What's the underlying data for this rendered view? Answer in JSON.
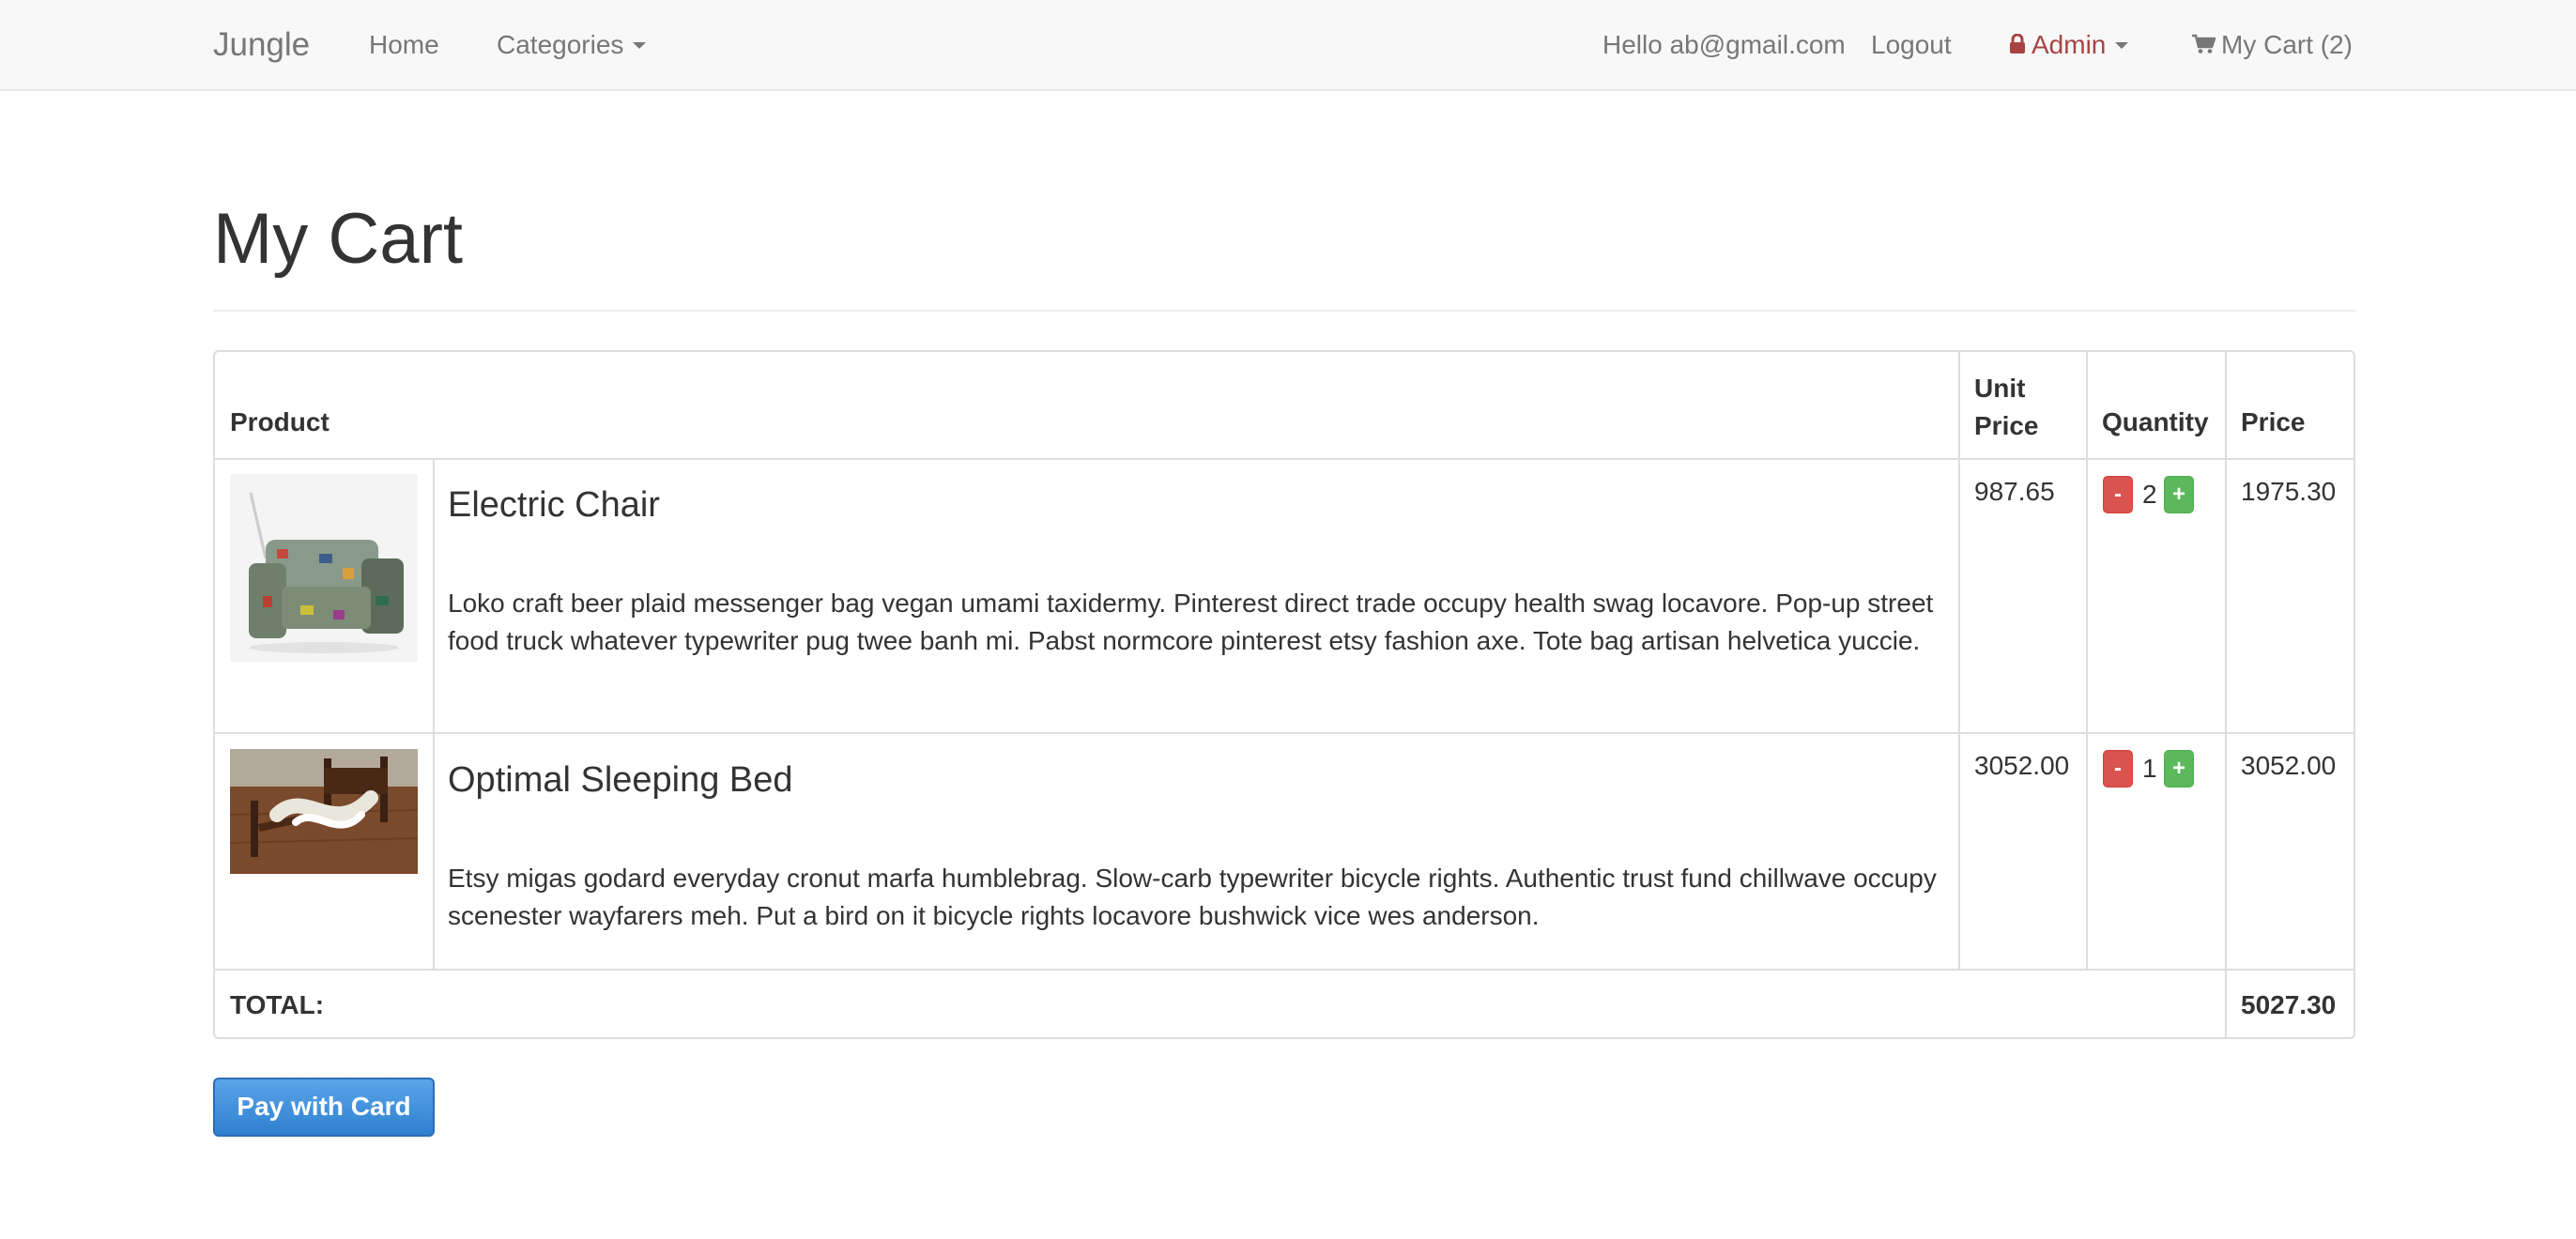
{
  "navbar": {
    "brand": "Jungle",
    "home": "Home",
    "categories": "Categories",
    "greeting": "Hello ab@gmail.com",
    "logout": "Logout",
    "admin": "Admin",
    "cart": "My Cart (2)"
  },
  "page": {
    "title": "My Cart"
  },
  "table": {
    "headers": {
      "product": "Product",
      "unit_price_line1": "Unit",
      "unit_price_line2": "Price",
      "quantity": "Quantity",
      "price": "Price"
    },
    "rows": [
      {
        "name": "Electric Chair",
        "description": "Loko craft beer plaid messenger bag vegan umami taxidermy. Pinterest direct trade occupy health swag locavore. Pop-up street food truck whatever typewriter pug twee banh mi. Pabst normcore pinterest etsy fashion axe. Tote bag artisan helvetica yuccie.",
        "unit_price": "987.65",
        "quantity": "2",
        "price": "1975.30",
        "minus": "-",
        "plus": "+"
      },
      {
        "name": "Optimal Sleeping Bed",
        "description": "Etsy migas godard everyday cronut marfa humblebrag. Slow-carb typewriter bicycle rights. Authentic trust fund chillwave occupy scenester wayfarers meh. Put a bird on it bicycle rights locavore bushwick vice wes anderson.",
        "unit_price": "3052.00",
        "quantity": "1",
        "price": "3052.00",
        "minus": "-",
        "plus": "+"
      }
    ],
    "total_label": "TOTAL:",
    "total_value": "5027.30"
  },
  "pay_button": "Pay with Card",
  "icons": {
    "lock": "lock-icon",
    "cart": "shopping-cart-icon"
  },
  "colors": {
    "admin_text": "#a94442",
    "pay_button": "#3a8bd9",
    "minus_button": "#d9534f",
    "plus_button": "#5cb85c"
  }
}
